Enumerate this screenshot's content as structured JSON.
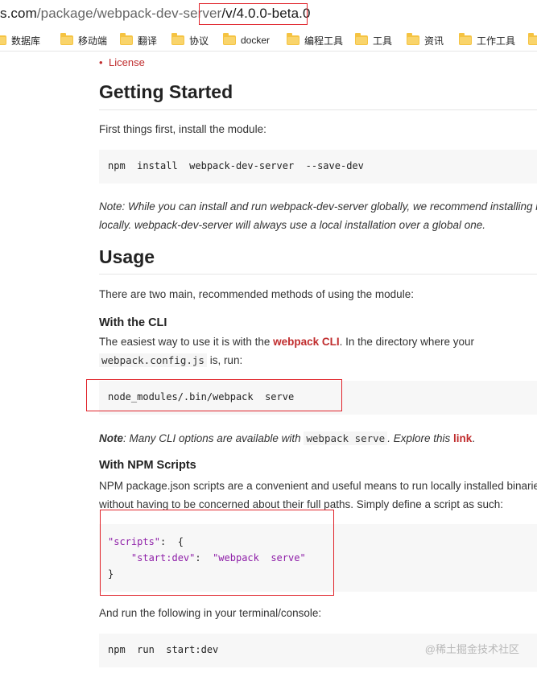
{
  "browser": {
    "url_prefix": "s.com",
    "url_path": "/package/webpack-dev-server",
    "url_version": "/v/4.0.0-beta.0",
    "bookmarks": [
      "数据库",
      "移动端",
      "翻译",
      "协议",
      "docker",
      "编程工具",
      "工具",
      "资讯",
      "工作工具"
    ]
  },
  "page": {
    "toc_license": "License",
    "getting_started": {
      "heading": "Getting Started",
      "intro": "First things first, install the module:",
      "install_cmd": "npm  install  webpack-dev-server  --save-dev",
      "note_line1": "Note: While you can install and run webpack-dev-server globally, we recommend installing it",
      "note_line2": "locally. webpack-dev-server will always use a local installation over a global one."
    },
    "usage": {
      "heading": "Usage",
      "intro": "There are two main, recommended methods of using the module:",
      "cli": {
        "heading": "With the CLI",
        "line1_before": "The easiest way to use it is with the ",
        "line1_link": "webpack CLI",
        "line1_after": ". In the directory where your",
        "config_file": "webpack.config.js",
        "line2_after": " is, run:",
        "cmd": "node_modules/.bin/webpack  serve",
        "note_label": "Note",
        "note_text": ": Many CLI options are available with ",
        "note_code": "webpack serve",
        "note_after": ". Explore this ",
        "note_link": "link",
        "note_end": "."
      },
      "npm": {
        "heading": "With NPM Scripts",
        "line1": "NPM package.json scripts are a convenient and useful means to run locally installed binaries",
        "line2": "without having to be concerned about their full paths. Simply define a script as such:",
        "code_line1_key": "\"scripts\"",
        "code_line1_rest": ":  {",
        "code_line2_key": "\"start:dev\"",
        "code_line2_sep": ":  ",
        "code_line2_val": "\"webpack  serve\"",
        "code_line3": "}",
        "run_text": "And run the following in your terminal/console:",
        "run_cmd": "npm  run  start:dev"
      }
    },
    "watermark": "@稀土掘金技术社区"
  }
}
